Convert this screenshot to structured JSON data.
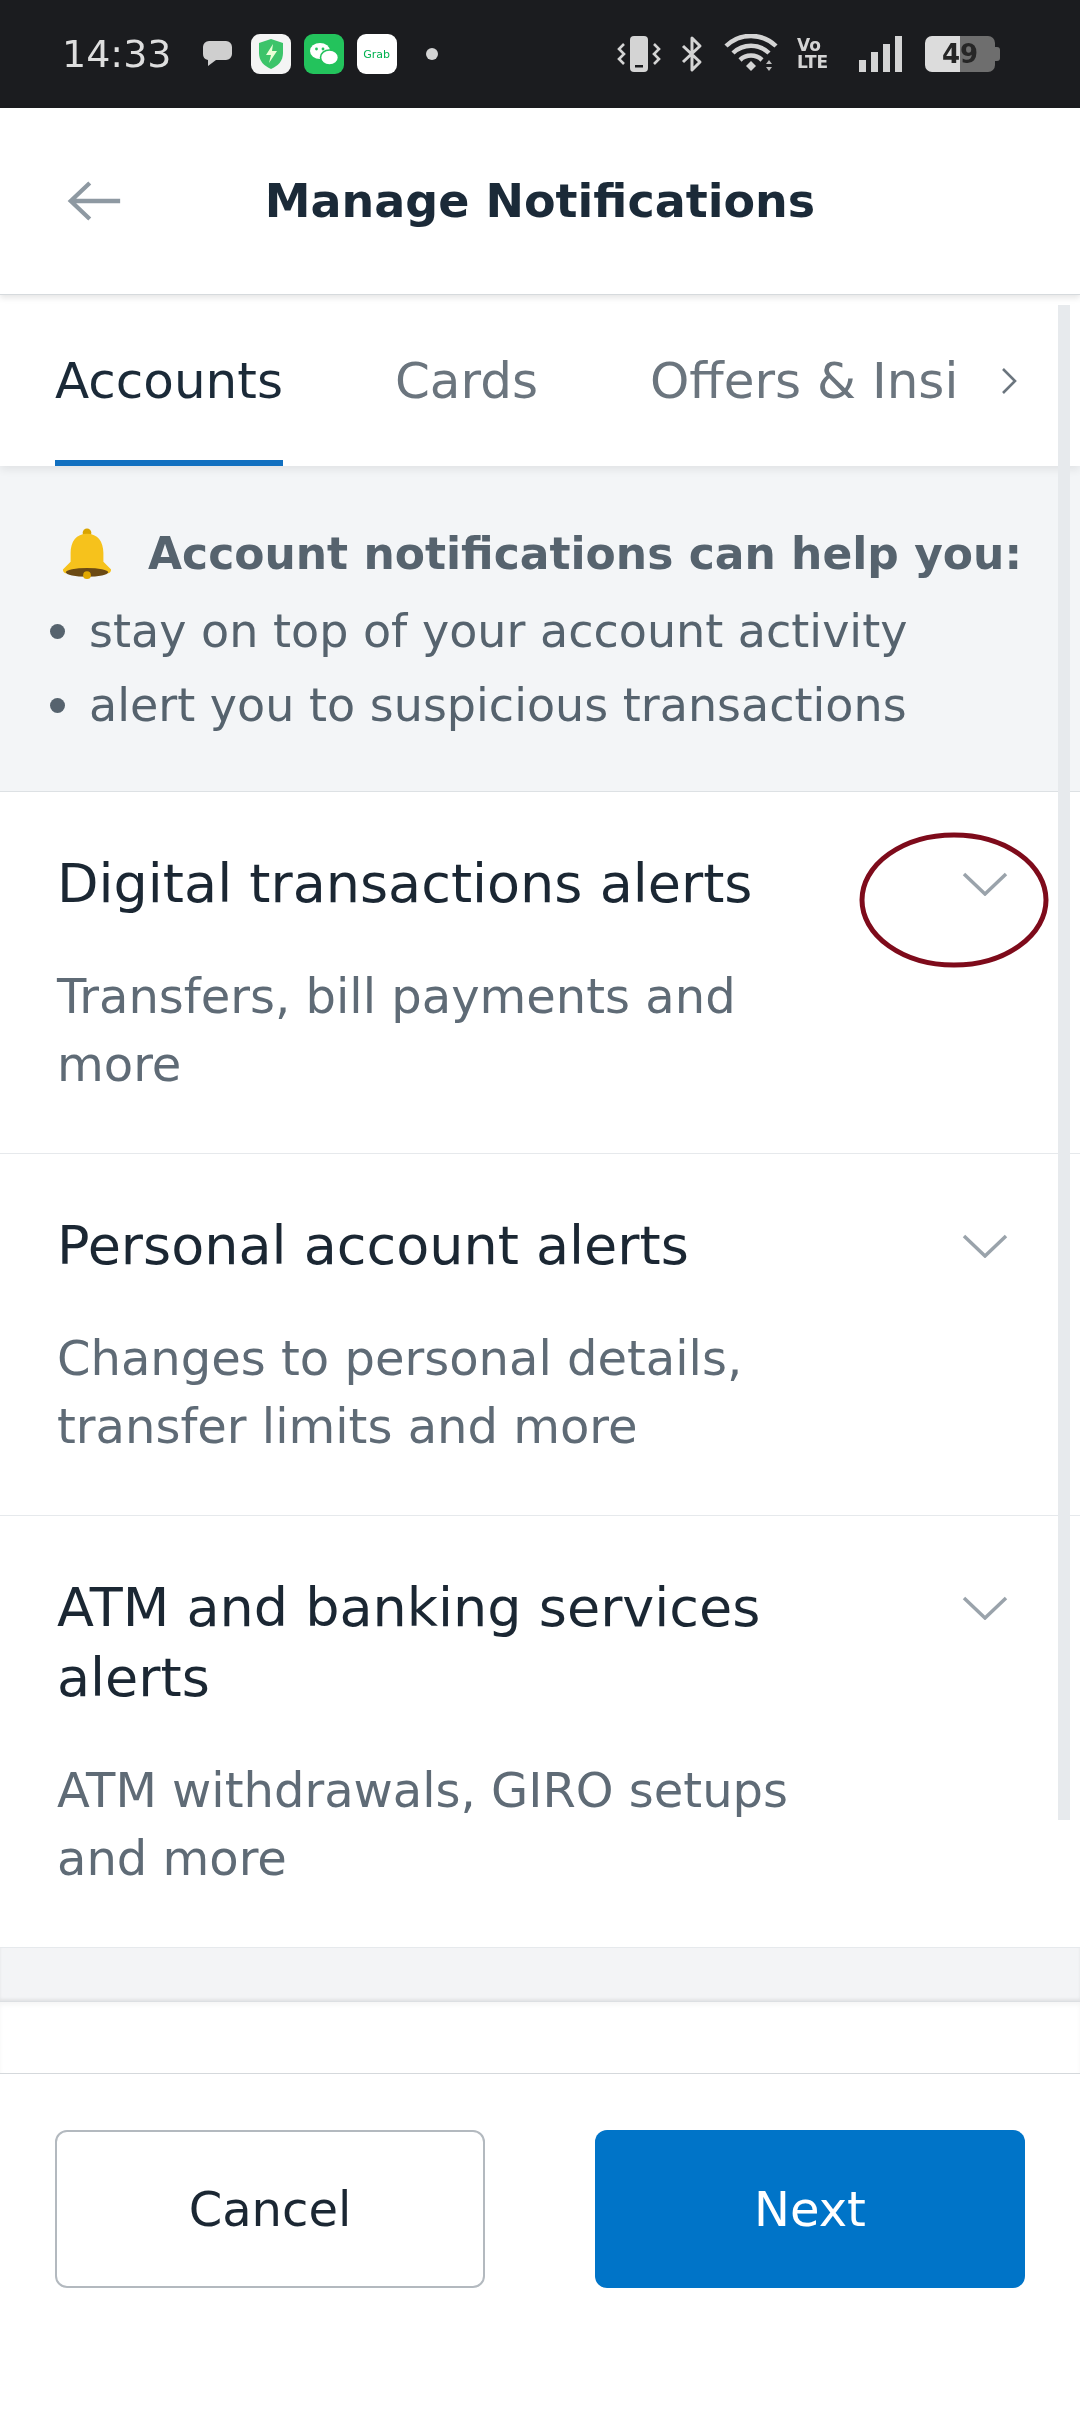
{
  "status_bar": {
    "time": "14:33",
    "app_icon_text": "Grab",
    "network_type": "Vo LTE",
    "battery_percent": "49"
  },
  "header": {
    "title": "Manage Notifications"
  },
  "tabs": [
    {
      "label": "Accounts",
      "selected": true
    },
    {
      "label": "Cards",
      "selected": false
    },
    {
      "label": "Offers & Insi",
      "selected": false
    }
  ],
  "info_panel": {
    "heading": "Account notifications can help you:",
    "bullets": [
      "stay on top of your account activity",
      "alert you to suspicious transactions"
    ]
  },
  "alerts": [
    {
      "title": "Digital transactions alerts",
      "description": "Transfers, bill payments and more",
      "expanded": false,
      "circled": true
    },
    {
      "title": "Personal account alerts",
      "description": "Changes to personal details, transfer limits and more",
      "expanded": false,
      "circled": false
    },
    {
      "title": "ATM and banking services alerts",
      "description": "ATM withdrawals, GIRO setups and more",
      "expanded": false,
      "circled": false
    }
  ],
  "footer": {
    "buttons": [
      {
        "label": "Cancel",
        "kind": "secondary"
      },
      {
        "label": "Next",
        "kind": "primary"
      }
    ]
  }
}
